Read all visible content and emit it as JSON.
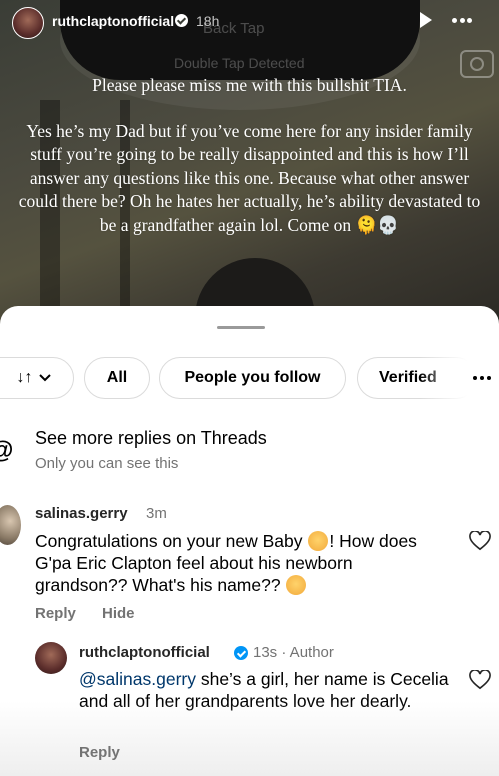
{
  "story": {
    "username": "ruthclaptonofficial",
    "time": "18h",
    "overlay_back_tap": "Back Tap",
    "overlay_double_tap": "Double Tap Detected",
    "paragraph1": "Please please miss me with this bullshit TIA.",
    "paragraph2": "Yes he’s my Dad but if you’ve come here for any insider family stuff you’re going to be really disappointed and this is how I’ll answer any questions like this one. Because what other answer could there be? Oh he hates her actually, he’s ability devastated to be a grandfather again lol. Come on 🫠💀"
  },
  "filters": {
    "sort_label": "↓↑",
    "chips": [
      "All",
      "People you follow",
      "Verified"
    ]
  },
  "threads": {
    "title": "See more replies on Threads",
    "subtitle": "Only you can see this"
  },
  "comment": {
    "username": "salinas.gerry",
    "time": "3m",
    "text_part1": "Congratulations on your new Baby ",
    "text_part2": "! How does G'pa Eric Clapton feel about his newborn grandson?? What's his name??",
    "reply": "Reply",
    "hide": "Hide"
  },
  "reply": {
    "username": "ruthclaptonofficial",
    "meta": "13s · Author",
    "mention": "@salinas.gerry",
    "text": " she’s a girl, her name is Cecelia and all of her grandparents love her dearly.",
    "reply": "Reply"
  },
  "colors": {
    "verified_blue": "#0095f6",
    "secondary_text": "#737373",
    "mention": "#00376b"
  }
}
